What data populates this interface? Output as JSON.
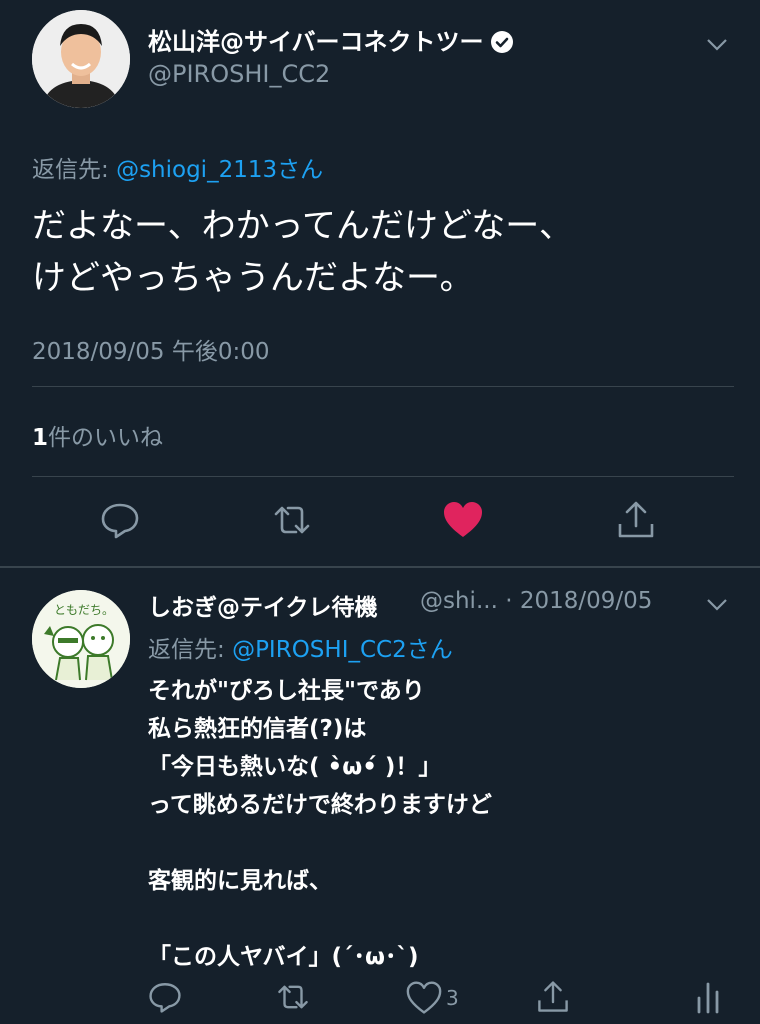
{
  "main_tweet": {
    "display_name": "松山洋@サイバーコネクトツー",
    "handle": "@PIROSHI_CC2",
    "reply_prefix": "返信先: ",
    "reply_to": "@shiogi_2113さん",
    "body_lines": [
      "だよなー、わかってんだけどなー、",
      "けどやっちゃうんだよなー。"
    ],
    "timestamp": "2018/09/05 午後0:00",
    "like_count": "1",
    "like_label": "件のいいね",
    "liked_color": "#e0245e"
  },
  "reply_tweet": {
    "display_name": "しおぎ@テイクレ待機",
    "handle_date": "@shi... · 2018/09/05",
    "reply_prefix": "返信先: ",
    "reply_to": "@PIROSHI_CC2さん",
    "avatar_text": "ともだち。",
    "body_lines": [
      "それが\"ぴろし社長\"であり",
      "私ら熱狂的信者(?)は",
      "「今日も熱いな( •̀ω•́ )！」",
      "って眺めるだけで終わりますけど",
      "",
      "客観的に見れば、",
      "",
      "「この人ヤバイ」(´･ω･`)"
    ],
    "like_count": "3"
  },
  "icons": [
    "verified-badge-icon",
    "chevron-down-icon",
    "reply-icon",
    "retweet-icon",
    "heart-icon",
    "share-icon",
    "analytics-icon"
  ]
}
